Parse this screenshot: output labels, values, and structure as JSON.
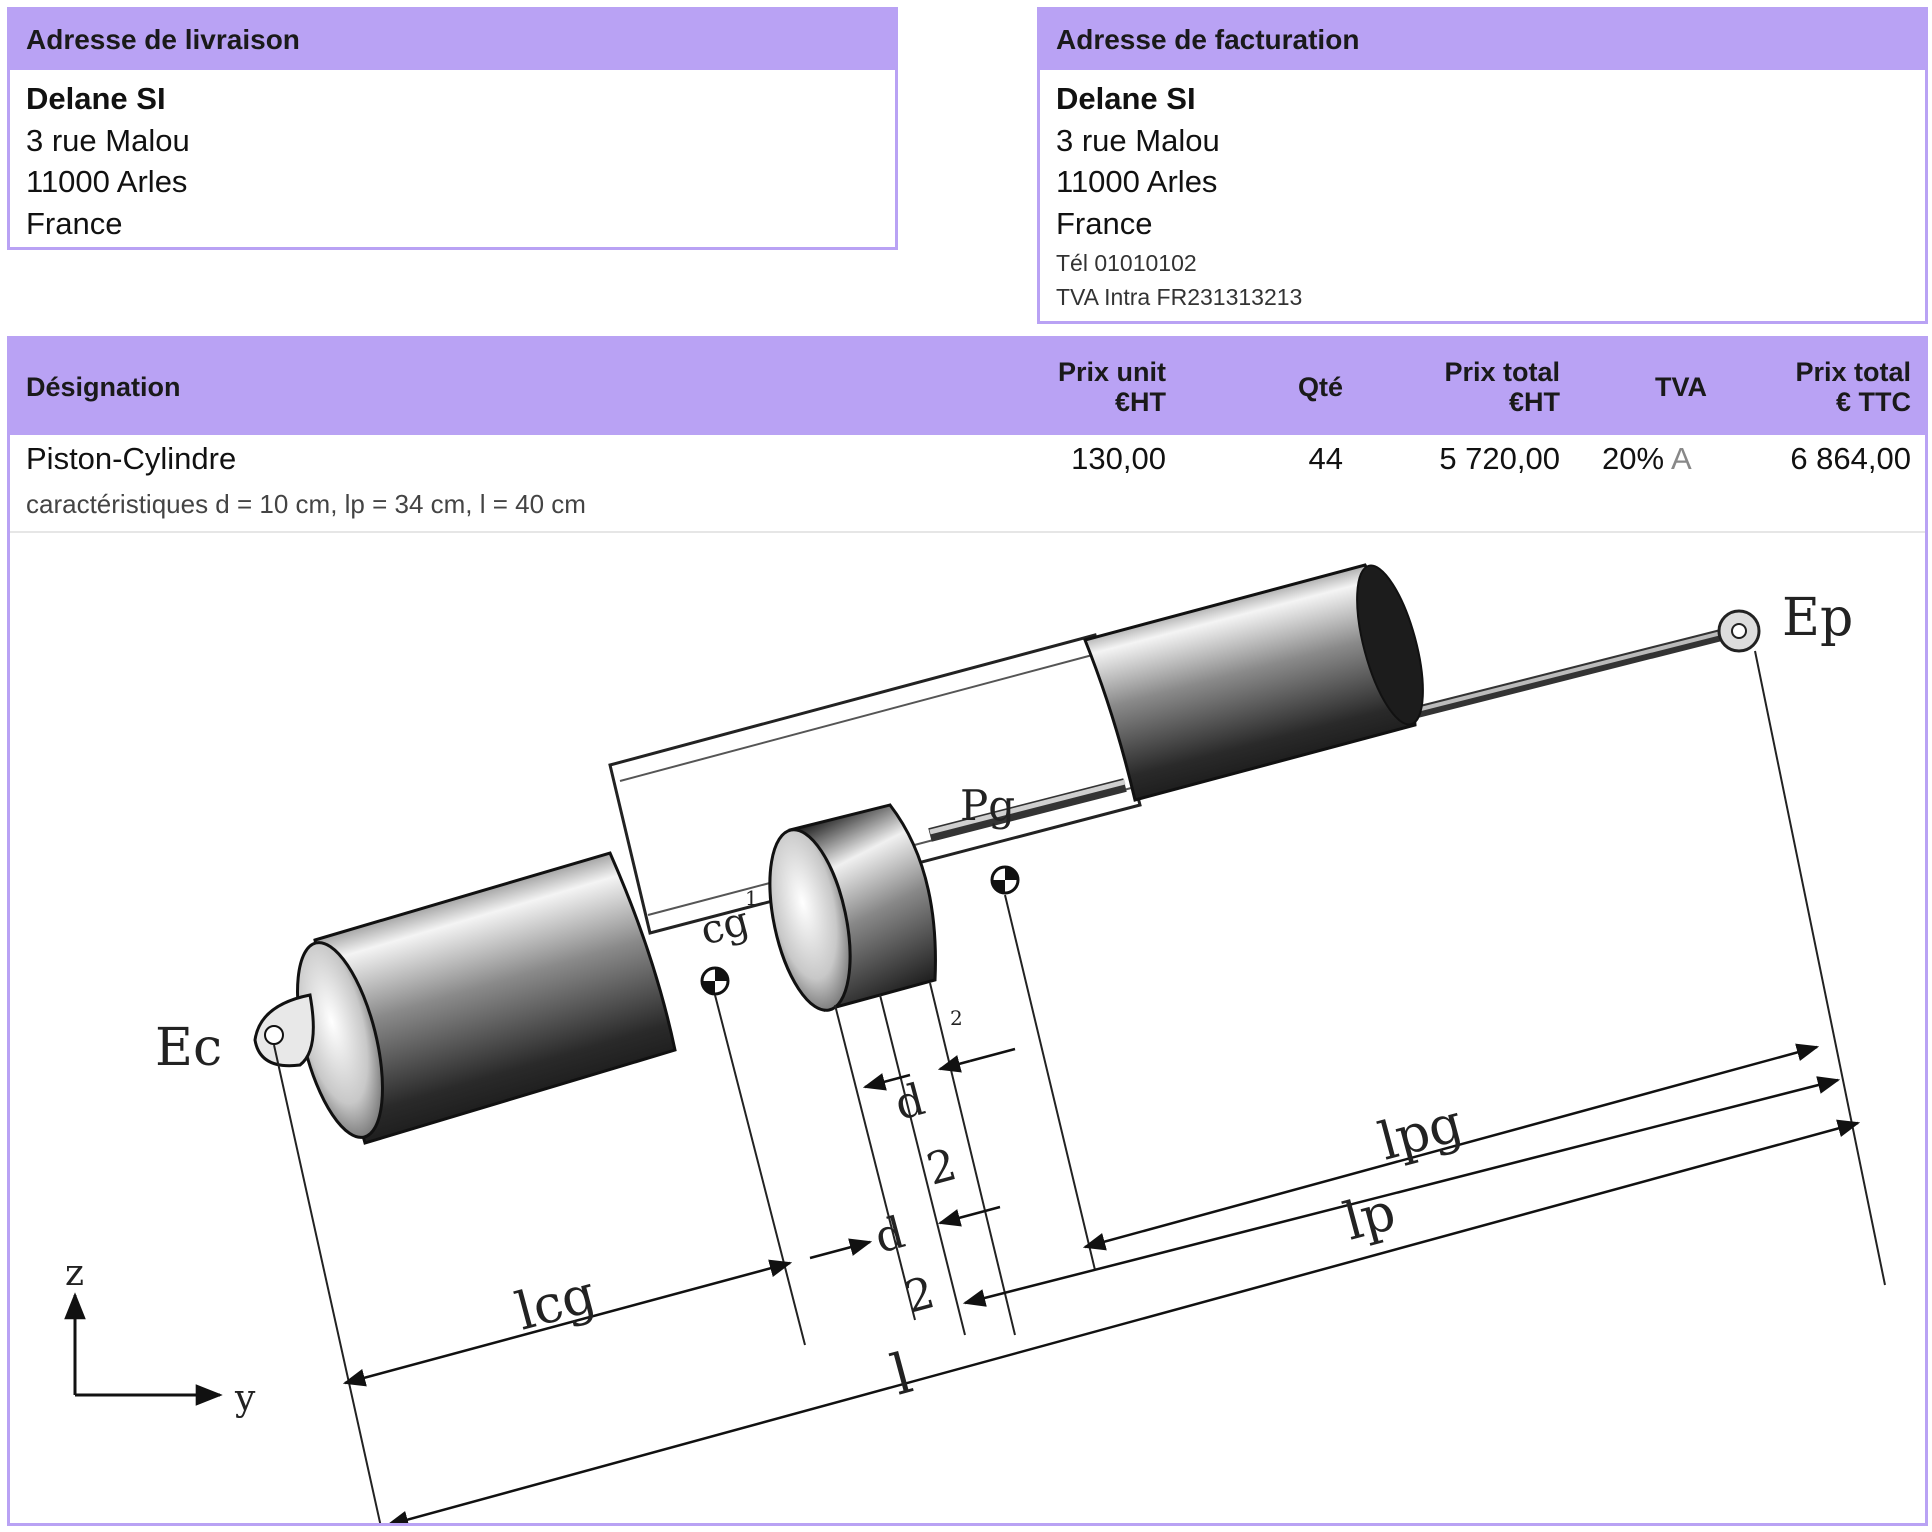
{
  "shipping": {
    "title": "Adresse de livraison",
    "name": "Delane SI",
    "street": "3 rue Malou",
    "city": "11000 Arles",
    "country": "France"
  },
  "billing": {
    "title": "Adresse de facturation",
    "name": "Delane SI",
    "street": "3 rue Malou",
    "city": "11000 Arles",
    "country": "France",
    "phone": "Tél 01010102",
    "vat": "TVA Intra FR231313213"
  },
  "table": {
    "headers": {
      "designation": "Désignation",
      "unit_price_l1": "Prix unit",
      "unit_price_l2": "€HT",
      "qty": "Qté",
      "total_ht_l1": "Prix total",
      "total_ht_l2": "€HT",
      "tva": "TVA",
      "total_ttc_l1": "Prix total",
      "total_ttc_l2": "€ TTC"
    },
    "rows": [
      {
        "designation": "Piston-Cylindre",
        "unit_price": "130,00",
        "qty": "44",
        "total_ht": "5 720,00",
        "tva_rate": "20%",
        "tva_code": "A",
        "total_ttc": "6 864,00",
        "details": "caractéristiques d = 10 cm, lp = 34 cm, l = 40 cm"
      }
    ]
  },
  "figure": {
    "labels": {
      "ep": "Ep",
      "ec": "Ec",
      "pg": "Pg",
      "cg": "cg",
      "lpg": "lpg",
      "lp": "lp",
      "lcg": "lcg",
      "l": "l",
      "d": "d",
      "two": "2",
      "z": "z",
      "y": "y",
      "one": "1"
    }
  }
}
